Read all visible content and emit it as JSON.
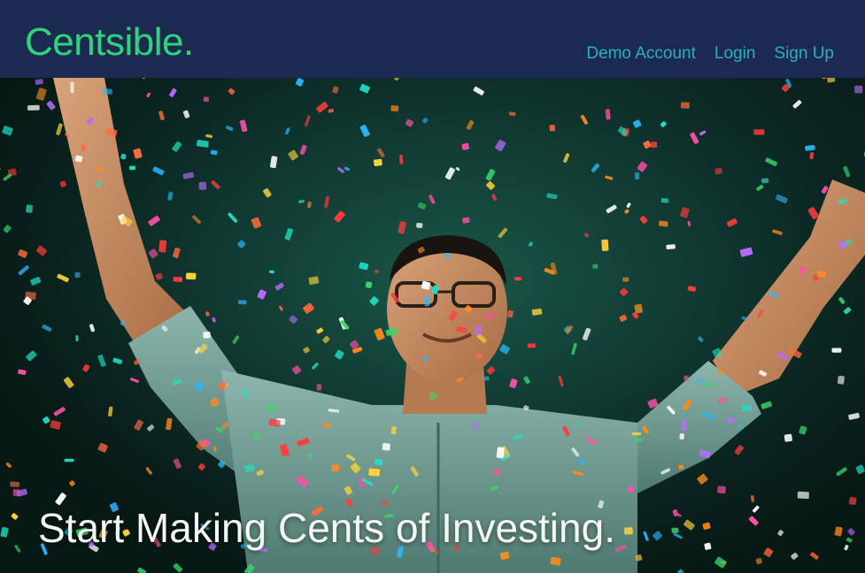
{
  "header": {
    "brand": "Centsible.",
    "nav": [
      {
        "label": "Demo Account"
      },
      {
        "label": "Login"
      },
      {
        "label": "Sign Up"
      }
    ]
  },
  "hero": {
    "headline": "Start Making Cents of Investing.",
    "image": "celebrating-man-with-confetti"
  },
  "colors": {
    "nav_background": "#1c2a52",
    "brand": "#2fd47a",
    "nav_link": "#29b2b6",
    "headline": "#f4f6f2",
    "hero_background": "#0f3530"
  }
}
